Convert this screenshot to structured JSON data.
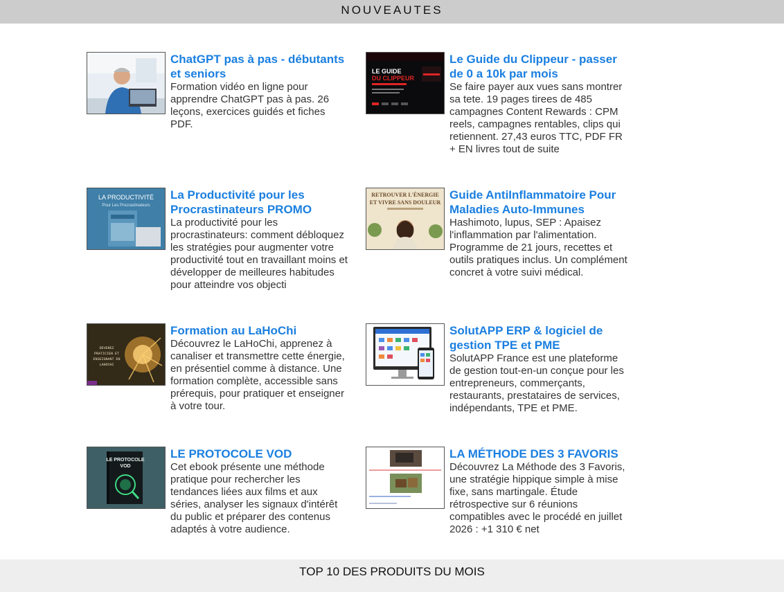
{
  "header": {
    "title": "NOUVEAUTES"
  },
  "footer": {
    "title": "TOP 10 DES PRODUITS DU MOIS"
  },
  "products": [
    {
      "title": "ChatGPT pas à pas - débutants et seniors",
      "description": "Formation vidéo en ligne pour apprendre ChatGPT pas à pas. 26 leçons, exercices guidés et fiches PDF."
    },
    {
      "title": "Le Guide du Clippeur - passer de 0 a 10k par mois",
      "description": "Se faire payer aux vues sans montrer sa tete. 19 pages tirees de 485 campagnes Content Rewards : CPM reels, campagnes rentables, clips qui retiennent. 27,43 euros TTC, PDF FR + EN livres tout de suite",
      "image_text": [
        "LE GUIDE",
        "DU CLIPPEUR"
      ]
    },
    {
      "title": "La Productivité pour les Procrastinateurs PROMO",
      "description": "La productivité pour les procrastinateurs: comment débloquez les stratégies pour augmenter votre productivité tout en travaillant moins et développer de meilleures habitudes pour atteindre vos objecti",
      "image_text": [
        "LA PRODUCTIVITÉ",
        "Pour Les Procrastinateurs"
      ]
    },
    {
      "title": "Guide AntiInflammatoire Pour Maladies Auto-Immunes",
      "description": "Hashimoto, lupus, SEP : Apaisez l'inflammation par l'alimentation. Programme de 21 jours, recettes et outils pratiques inclus. Un complément concret à votre suivi médical.",
      "image_text": [
        "RETROUVER L'ÉNERGIE",
        "ET VIVRE SANS DOULEUR"
      ]
    },
    {
      "title": "Formation au LaHoChi",
      "description": "Découvrez le LaHoChi, apprenez à canaliser et transmettre cette énergie, en présentiel comme à distance. Une formation complète, accessible sans prérequis, pour pratiquer et enseigner à votre tour.",
      "image_text": [
        "DEVENEZ",
        "PRATICIEN ET",
        "ENSEIGNANT EN",
        "LAHOCHI"
      ]
    },
    {
      "title": "SolutAPP ERP & logiciel de gestion TPE et PME",
      "description": "SolutAPP France est une plateforme de gestion tout-en-un conçue pour les entrepreneurs, commerçants, restaurants, prestataires de services, indépendants, TPE et PME."
    },
    {
      "title": "LE PROTOCOLE VOD",
      "description": "Cet ebook présente une méthode pratique pour rechercher les tendances liées aux films et aux séries, analyser les signaux d'intérêt du public et préparer des contenus adaptés à votre audience.",
      "image_text": [
        "LE PROTOCOLE",
        "VOD"
      ]
    },
    {
      "title": "LA MÉTHODE DES 3 FAVORIS",
      "description": "Découvrez La Méthode des 3 Favoris, une stratégie hippique simple à mise fixe, sans martingale. Étude rétrospective sur 6 réunions compatibles avec le procédé en juillet 2026 : +1 310 € net"
    }
  ],
  "colors": {
    "link": "#1a7fe0",
    "header_bg": "#cccccc",
    "footer_bg": "#eeeeee",
    "text": "#333333"
  }
}
